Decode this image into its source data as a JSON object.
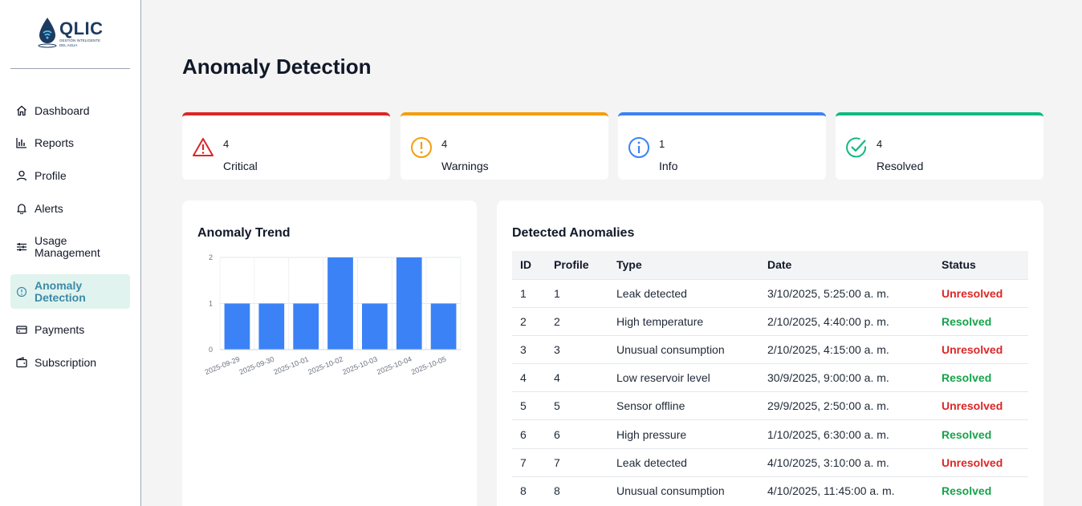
{
  "brand": {
    "name": "QLIC",
    "tagline_1": "GESTIÓN INTELIGENTE",
    "tagline_2": "DEL AGUA"
  },
  "sidebar": {
    "items": [
      {
        "label": "Dashboard",
        "icon": "home-icon",
        "active": false
      },
      {
        "label": "Reports",
        "icon": "bar-chart-icon",
        "active": false
      },
      {
        "label": "Profile",
        "icon": "user-icon",
        "active": false
      },
      {
        "label": "Alerts",
        "icon": "bell-icon",
        "active": false
      },
      {
        "label": "Usage Management",
        "icon": "sliders-icon",
        "active": false
      },
      {
        "label": "Anomaly Detection",
        "icon": "alert-circle-icon",
        "active": true
      },
      {
        "label": "Payments",
        "icon": "credit-card-icon",
        "active": false
      },
      {
        "label": "Subscription",
        "icon": "wallet-icon",
        "active": false
      }
    ]
  },
  "page": {
    "title": "Anomaly Detection"
  },
  "stats": [
    {
      "value": "4",
      "label": "Critical",
      "color": "#dc2626",
      "icon": "warning-triangle-icon"
    },
    {
      "value": "4",
      "label": "Warnings",
      "color": "#f59e0b",
      "icon": "exclamation-circle-icon"
    },
    {
      "value": "1",
      "label": "Info",
      "color": "#3b82f6",
      "icon": "info-circle-icon"
    },
    {
      "value": "4",
      "label": "Resolved",
      "color": "#10b981",
      "icon": "check-circle-icon"
    }
  ],
  "trend": {
    "title": "Anomaly Trend",
    "chart_data": {
      "type": "bar",
      "categories": [
        "2025-09-29",
        "2025-09-30",
        "2025-10-01",
        "2025-10-02",
        "2025-10-03",
        "2025-10-04",
        "2025-10-05"
      ],
      "values": [
        1,
        1,
        1,
        2,
        1,
        2,
        1
      ],
      "ylim": [
        0,
        2
      ],
      "yticks": [
        "0",
        "1",
        "2"
      ],
      "grid": true,
      "bar_color": "#3b82f6"
    }
  },
  "anomalies": {
    "title": "Detected Anomalies",
    "columns": [
      "ID",
      "Profile",
      "Type",
      "Date",
      "Status"
    ],
    "rows": [
      {
        "id": "1",
        "profile": "1",
        "type": "Leak detected",
        "date": "3/10/2025, 5:25:00 a. m.",
        "status": "Unresolved"
      },
      {
        "id": "2",
        "profile": "2",
        "type": "High temperature",
        "date": "2/10/2025, 4:40:00 p. m.",
        "status": "Resolved"
      },
      {
        "id": "3",
        "profile": "3",
        "type": "Unusual consumption",
        "date": "2/10/2025, 4:15:00 a. m.",
        "status": "Unresolved"
      },
      {
        "id": "4",
        "profile": "4",
        "type": "Low reservoir level",
        "date": "30/9/2025, 9:00:00 a. m.",
        "status": "Resolved"
      },
      {
        "id": "5",
        "profile": "5",
        "type": "Sensor offline",
        "date": "29/9/2025, 2:50:00 a. m.",
        "status": "Unresolved"
      },
      {
        "id": "6",
        "profile": "6",
        "type": "High pressure",
        "date": "1/10/2025, 6:30:00 a. m.",
        "status": "Resolved"
      },
      {
        "id": "7",
        "profile": "7",
        "type": "Leak detected",
        "date": "4/10/2025, 3:10:00 a. m.",
        "status": "Unresolved"
      },
      {
        "id": "8",
        "profile": "8",
        "type": "Unusual consumption",
        "date": "4/10/2025, 11:45:00 a. m.",
        "status": "Resolved"
      }
    ]
  }
}
